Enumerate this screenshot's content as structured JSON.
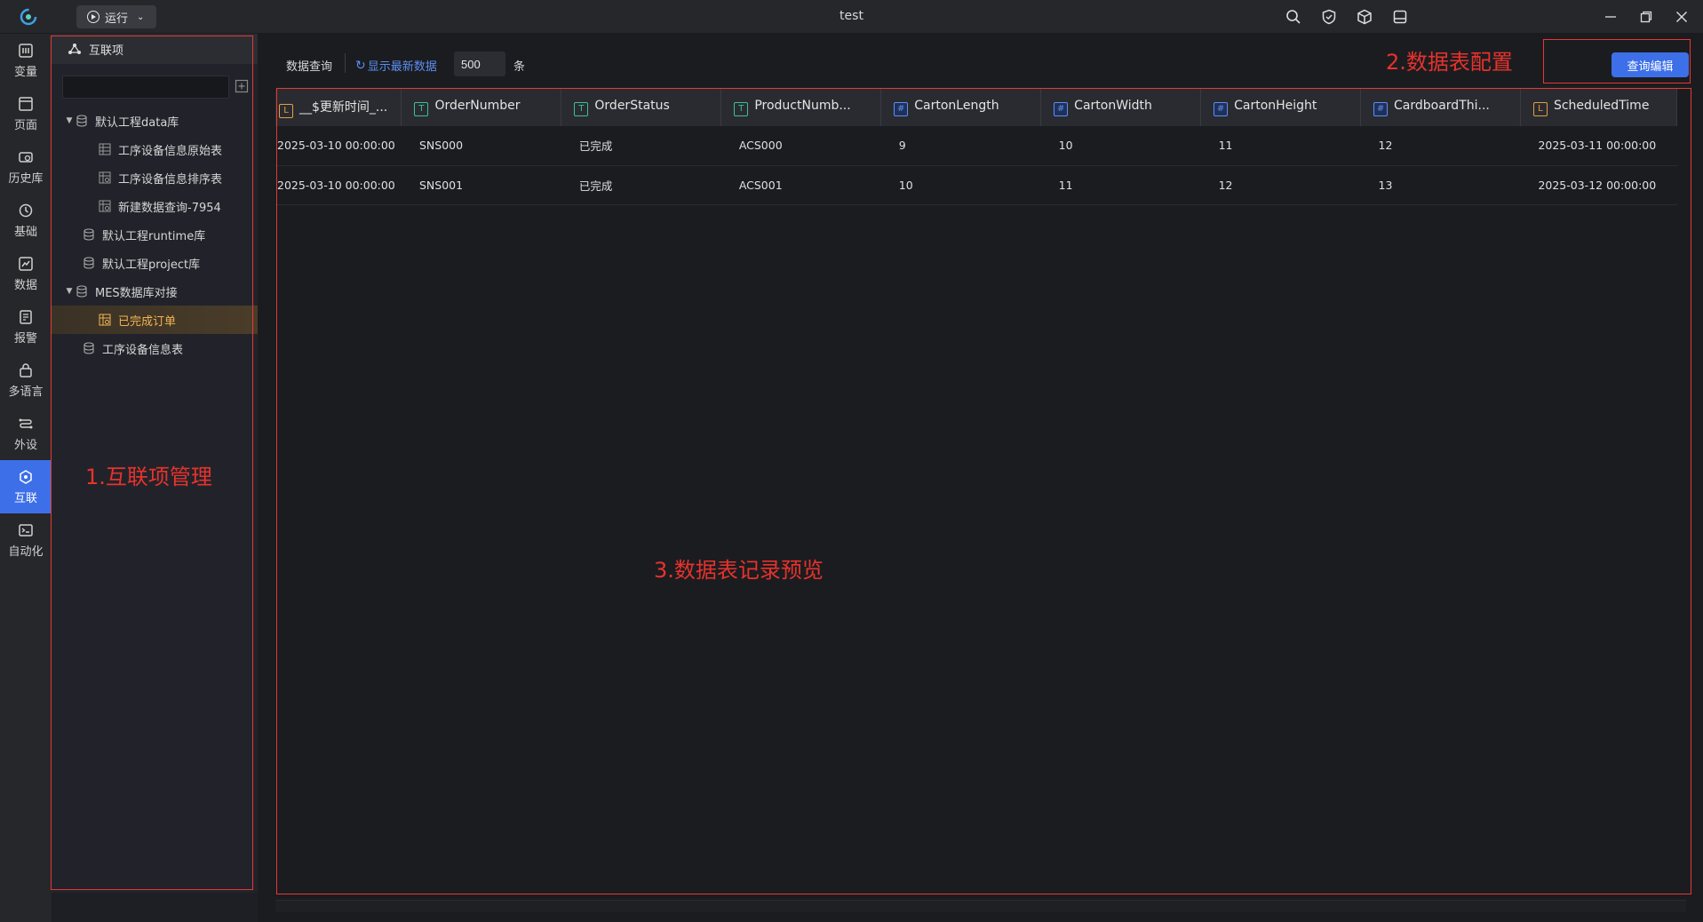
{
  "window": {
    "title": "test"
  },
  "run_button": {
    "label": "运行"
  },
  "left_nav": [
    {
      "label": "变量",
      "icon": "variable-icon"
    },
    {
      "label": "页面",
      "icon": "page-icon"
    },
    {
      "label": "历史库",
      "icon": "history-icon"
    },
    {
      "label": "基础",
      "icon": "basic-icon"
    },
    {
      "label": "数据",
      "icon": "data-icon"
    },
    {
      "label": "报警",
      "icon": "alarm-icon"
    },
    {
      "label": "多语言",
      "icon": "language-icon"
    },
    {
      "label": "外设",
      "icon": "peripheral-icon"
    },
    {
      "label": "互联",
      "icon": "interconnect-icon",
      "active": true
    },
    {
      "label": "自动化",
      "icon": "automation-icon"
    }
  ],
  "tree": {
    "header": "互联项",
    "search_value": "",
    "items": [
      {
        "label": "默认工程data库",
        "expanded": true
      },
      {
        "label": "工序设备信息原始表"
      },
      {
        "label": "工序设备信息排序表"
      },
      {
        "label": "新建数据查询-7954"
      },
      {
        "label": "默认工程runtime库"
      },
      {
        "label": "默认工程project库"
      },
      {
        "label": "MES数据库对接",
        "expanded": true
      },
      {
        "label": "已完成订单",
        "selected": true
      },
      {
        "label": "工序设备信息表"
      }
    ]
  },
  "toolbar": {
    "query_label": "数据查询",
    "refresh_label": "显示最新数据",
    "count_value": "500",
    "count_unit": "条",
    "query_edit_label": "查询编辑"
  },
  "table": {
    "columns": [
      {
        "name": "__$更新时间_...",
        "type": "L"
      },
      {
        "name": "OrderNumber",
        "type": "T"
      },
      {
        "name": "OrderStatus",
        "type": "T"
      },
      {
        "name": "ProductNumb...",
        "type": "T"
      },
      {
        "name": "CartonLength",
        "type": "#"
      },
      {
        "name": "CartonWidth",
        "type": "#"
      },
      {
        "name": "CartonHeight",
        "type": "#"
      },
      {
        "name": "CardboardThi...",
        "type": "#"
      },
      {
        "name": "ScheduledTime",
        "type": "L"
      }
    ],
    "rows": [
      [
        "2025-03-10 00:00:00",
        "SNS000",
        "已完成",
        "ACS000",
        "9",
        "10",
        "11",
        "12",
        "2025-03-11 00:00:00"
      ],
      [
        "2025-03-10 00:00:00",
        "SNS001",
        "已完成",
        "ACS001",
        "10",
        "11",
        "12",
        "13",
        "2025-03-12 00:00:00"
      ]
    ]
  },
  "annotations": {
    "a1": "1.互联项管理",
    "a2": "2.数据表配置",
    "a3": "3.数据表记录预览"
  },
  "colors": {
    "accent": "#3d6fe8",
    "annotation": "#e53935",
    "selected_text": "#f0b452"
  }
}
